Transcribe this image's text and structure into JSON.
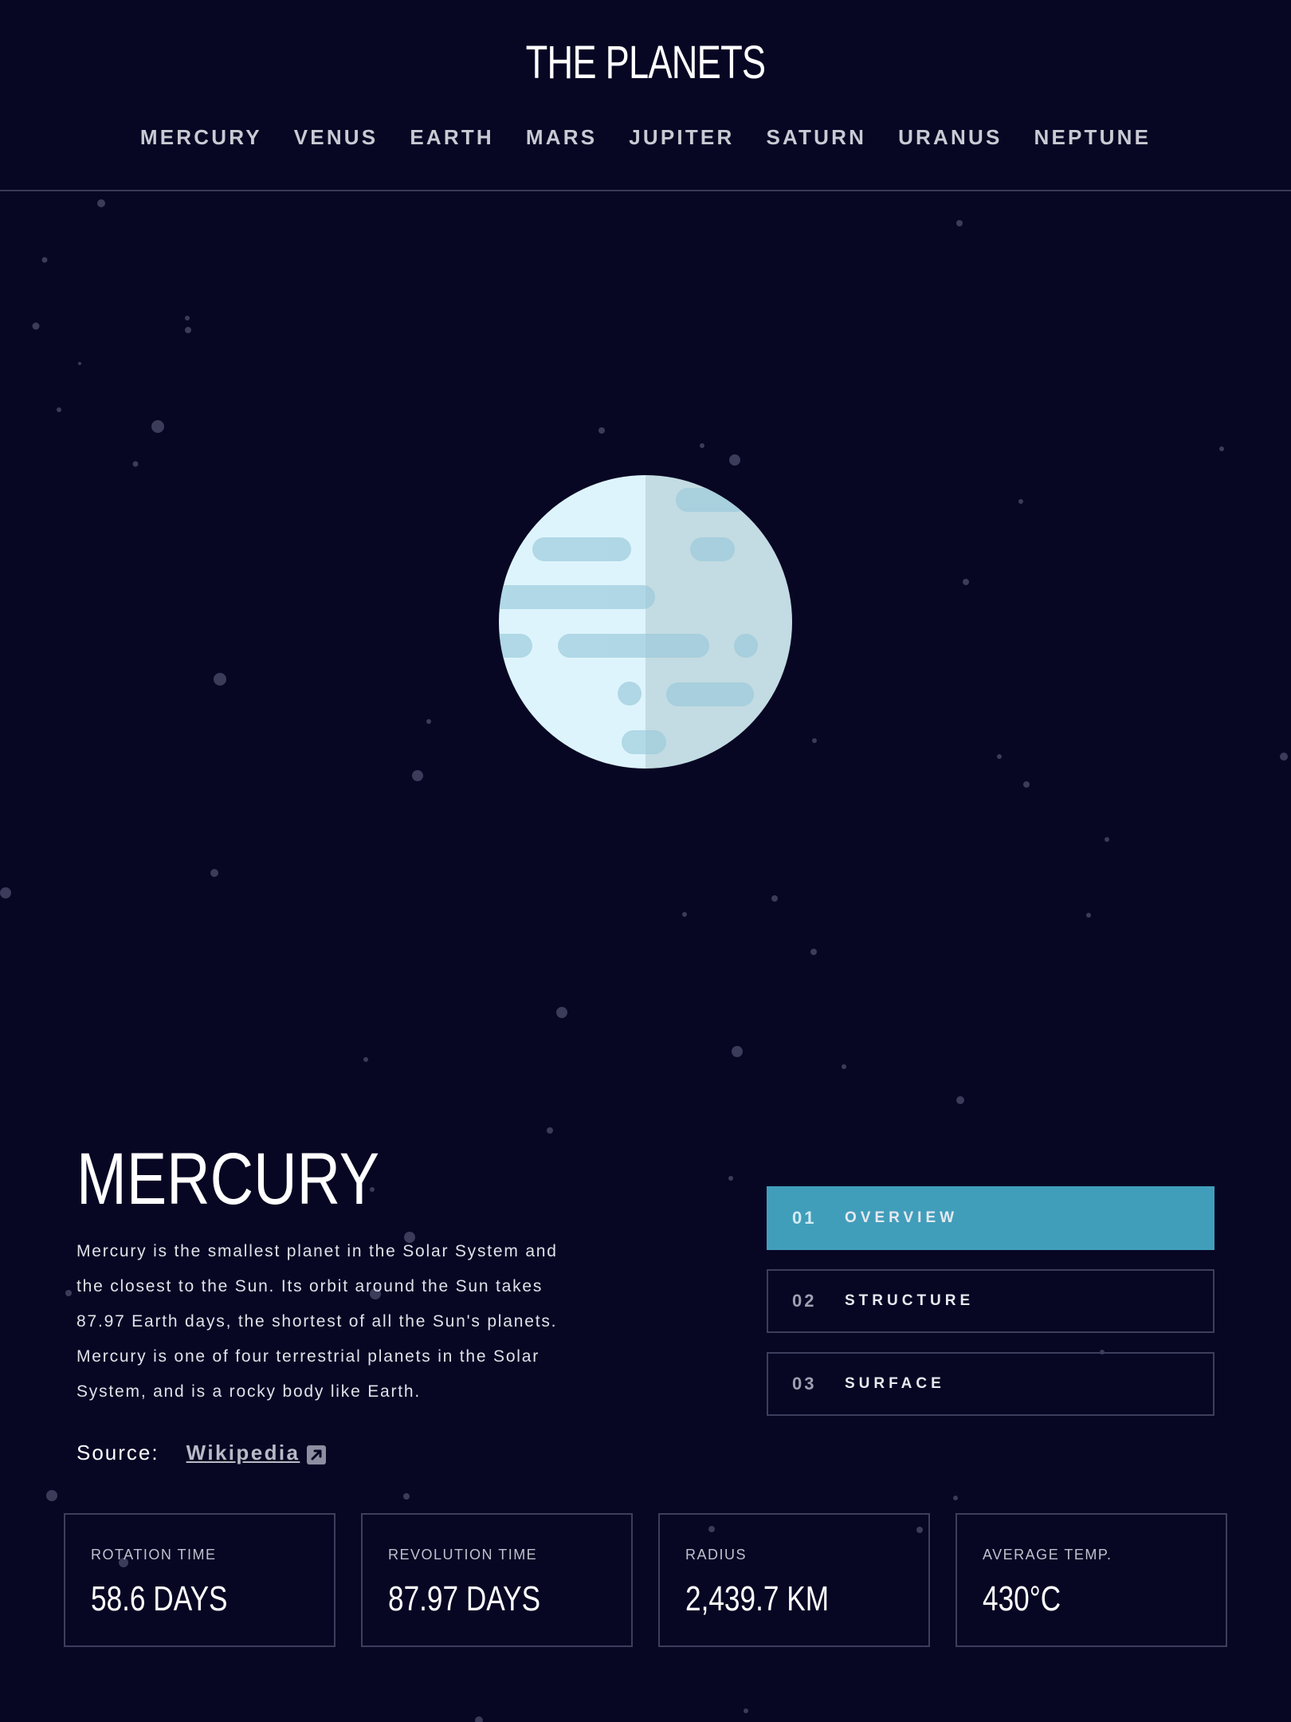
{
  "site": {
    "title": "THE PLANETS"
  },
  "nav": [
    "MERCURY",
    "VENUS",
    "EARTH",
    "MARS",
    "JUPITER",
    "SATURN",
    "URANUS",
    "NEPTUNE"
  ],
  "planet": {
    "name": "MERCURY",
    "description": "Mercury is the smallest planet in the Solar System and the closest to the Sun. Its orbit around the Sun takes 87.97 Earth days, the shortest of all the Sun's planets. Mercury is one of four terrestrial planets in the Solar System, and is a rocky body like Earth.",
    "source_label": "Source:",
    "source_link": "Wikipedia"
  },
  "tabs": [
    {
      "num": "01",
      "label": "OVERVIEW",
      "active": true
    },
    {
      "num": "02",
      "label": "STRUCTURE",
      "active": false
    },
    {
      "num": "03",
      "label": "SURFACE",
      "active": false
    }
  ],
  "stats": [
    {
      "label": "ROTATION TIME",
      "value": "58.6 DAYS"
    },
    {
      "label": "REVOLUTION TIME",
      "value": "87.97 DAYS"
    },
    {
      "label": "RADIUS",
      "value": "2,439.7 KM"
    },
    {
      "label": "AVERAGE TEMP.",
      "value": "430°C"
    }
  ],
  "colors": {
    "background": "#070724",
    "accent": "#419ebb",
    "border": "#3d3d5c",
    "planet_light": "#def4fc",
    "planet_shade": "#cde3e9",
    "planet_spots": "#a9d3e2"
  },
  "icons": {
    "external_link": "external-link-icon"
  }
}
